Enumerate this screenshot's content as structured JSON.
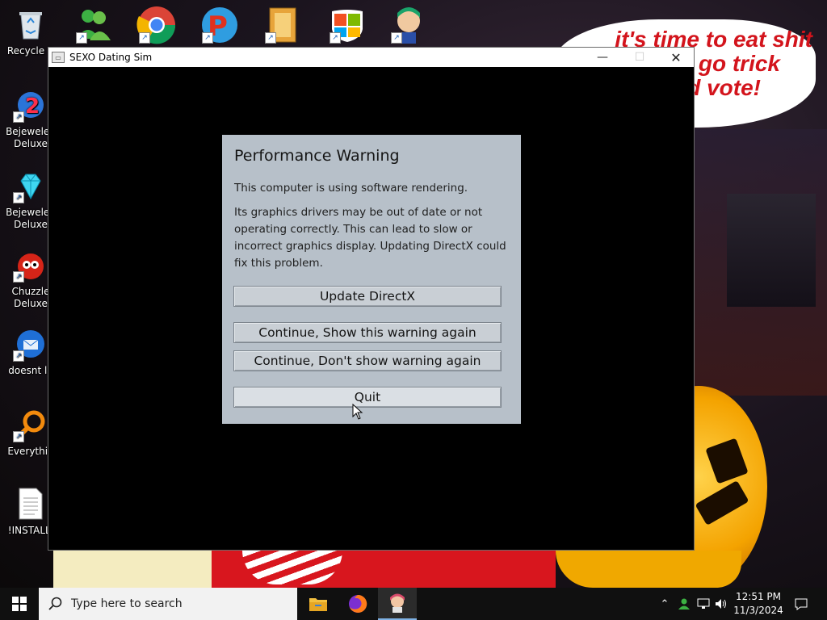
{
  "background": {
    "speech_bubble_lines": [
      "it's time to eat shit",
      "d go trick",
      "nd vote!"
    ],
    "speech_color": "#d3141c"
  },
  "desktop_icons_left": [
    {
      "label": "Recycle B",
      "icon": "recycle-bin-icon"
    },
    {
      "label": "Bejeweled Deluxe",
      "icon": "bejeweled-2-icon"
    },
    {
      "label": "Bejeweled Deluxe",
      "icon": "bejeweled-icon"
    },
    {
      "label": "Chuzzle Deluxe",
      "icon": "chuzzle-icon"
    },
    {
      "label": "doesnt lo",
      "icon": "thunderbird-icon"
    },
    {
      "label": "Everythin",
      "icon": "everything-search-icon"
    },
    {
      "label": "!INSTALLI",
      "icon": "text-file-icon"
    }
  ],
  "desktop_icons_top": [
    {
      "icon": "messenger-icon"
    },
    {
      "icon": "chrome-icon"
    },
    {
      "icon": "p-app-icon"
    },
    {
      "icon": "folder-shortcut-icon"
    },
    {
      "icon": "windows-logo-icon"
    },
    {
      "icon": "game-character-icon"
    }
  ],
  "window": {
    "title": "SEXO Dating Sim",
    "minimize": "—",
    "maximize": "☐",
    "close": "✕"
  },
  "dialog": {
    "title": "Performance Warning",
    "line1": "This computer is using software rendering.",
    "line2": "Its graphics drivers may be out of date or not operating correctly. This can lead to slow or incorrect graphics display. Updating DirectX could fix this problem.",
    "buttons": {
      "update": "Update DirectX",
      "continue_show": "Continue, Show this warning again",
      "continue_dont_show": "Continue, Don't show warning again",
      "quit": "Quit"
    }
  },
  "taskbar": {
    "search_placeholder": "Type here to search",
    "apps": [
      "file-explorer-icon",
      "firefox-icon",
      "dating-sim-icon"
    ],
    "clock_time": "12:51 PM",
    "clock_date": "11/3/2024"
  }
}
